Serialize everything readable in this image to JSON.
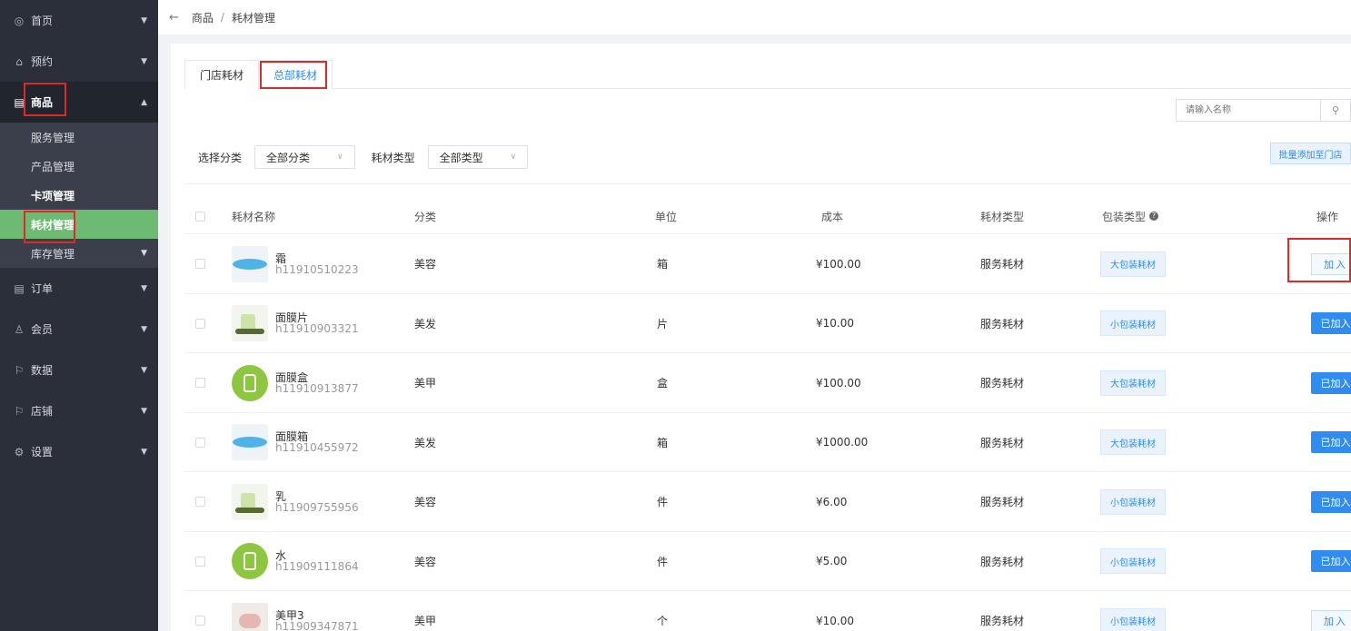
{
  "sidebar": {
    "items": [
      {
        "label": "首页",
        "icon": "dashboard-icon",
        "glyph": "◎"
      },
      {
        "label": "预约",
        "icon": "home-icon",
        "glyph": "⌂"
      },
      {
        "label": "商品",
        "icon": "goods-icon",
        "glyph": "▤"
      },
      {
        "label": "订单",
        "icon": "order-icon",
        "glyph": "▤"
      },
      {
        "label": "会员",
        "icon": "member-icon",
        "glyph": "♙"
      },
      {
        "label": "数据",
        "icon": "flag-icon",
        "glyph": "⚐"
      },
      {
        "label": "店铺",
        "icon": "flag-icon",
        "glyph": "⚐"
      },
      {
        "label": "设置",
        "icon": "gear-icon",
        "glyph": "⚙"
      }
    ],
    "submenu": [
      "服务管理",
      "产品管理",
      "卡项管理",
      "耗材管理",
      "库存管理"
    ]
  },
  "breadcrumb": {
    "back": "←",
    "parent": "商品",
    "separator": "/",
    "current": "耗材管理"
  },
  "tabs": [
    "门店耗材",
    "总部耗材"
  ],
  "search": {
    "placeholder": "请输入名称"
  },
  "filters": {
    "category_label": "选择分类",
    "category_value": "全部分类",
    "type_label": "耗材类型",
    "type_value": "全部类型"
  },
  "batch_button": "批量添加至门店",
  "table": {
    "headers": [
      "耗材名称",
      "分类",
      "单位",
      "成本",
      "耗材类型",
      "包装类型",
      "操作"
    ],
    "rows": [
      {
        "name": "霜",
        "code": "h11910510223",
        "category": "美容",
        "unit": "箱",
        "cost": "¥100.00",
        "type": "服务耗材",
        "pack": "大包装耗材",
        "action": "加入",
        "added": false,
        "thumb": "blue"
      },
      {
        "name": "面膜片",
        "code": "h11910903321",
        "category": "美发",
        "unit": "片",
        "cost": "¥10.00",
        "type": "服务耗材",
        "pack": "小包装耗材",
        "action": "已加入",
        "added": true,
        "thumb": "plant"
      },
      {
        "name": "面膜盒",
        "code": "h11910913877",
        "category": "美甲",
        "unit": "盒",
        "cost": "¥100.00",
        "type": "服务耗材",
        "pack": "大包装耗材",
        "action": "已加入",
        "added": true,
        "thumb": "green"
      },
      {
        "name": "面膜箱",
        "code": "h11910455972",
        "category": "美发",
        "unit": "箱",
        "cost": "¥1000.00",
        "type": "服务耗材",
        "pack": "大包装耗材",
        "action": "已加入",
        "added": true,
        "thumb": "blue"
      },
      {
        "name": "乳",
        "code": "h11909755956",
        "category": "美容",
        "unit": "件",
        "cost": "¥6.00",
        "type": "服务耗材",
        "pack": "小包装耗材",
        "action": "已加入",
        "added": true,
        "thumb": "plant"
      },
      {
        "name": "水",
        "code": "h11909111864",
        "category": "美容",
        "unit": "件",
        "cost": "¥5.00",
        "type": "服务耗材",
        "pack": "小包装耗材",
        "action": "已加入",
        "added": true,
        "thumb": "green"
      },
      {
        "name": "美甲3",
        "code": "h11909347871",
        "category": "美甲",
        "unit": "个",
        "cost": "¥10.00",
        "type": "服务耗材",
        "pack": "小包装耗材",
        "action": "加入",
        "added": false,
        "thumb": "hand"
      }
    ]
  },
  "colors": {
    "accent": "#2f8cf0",
    "sidebar": "#2b2f3a",
    "active_sub": "#6dbb72",
    "highlight": "#e0282a"
  }
}
